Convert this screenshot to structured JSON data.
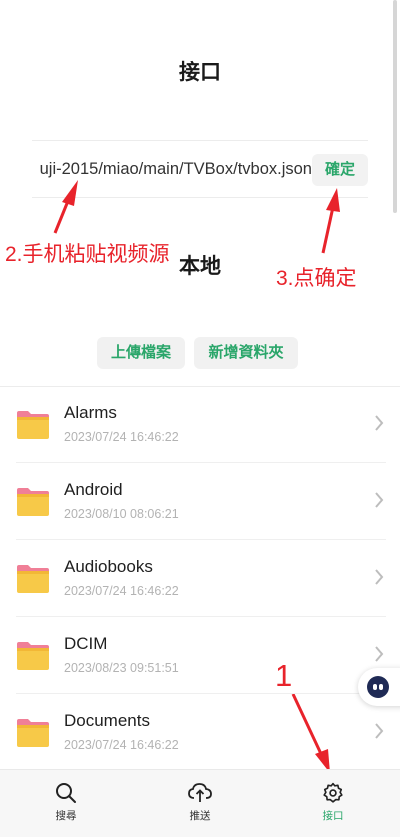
{
  "header": {
    "title": "接口"
  },
  "interface": {
    "url_value": "uji-2015/miao/main/TVBox/tvbox.json",
    "confirm_label": "確定"
  },
  "local": {
    "title": "本地",
    "upload_label": "上傳檔案",
    "new_folder_label": "新增資料夾"
  },
  "annotations": {
    "step2": "2.手机粘贴视频源",
    "step3": "3.点确定",
    "step1": "1",
    "color": "#e8232b"
  },
  "files": [
    {
      "name": "Alarms",
      "date": "2023/07/24 16:46:22",
      "icon": "folder-icon"
    },
    {
      "name": "Android",
      "date": "2023/08/10 08:06:21",
      "icon": "folder-icon"
    },
    {
      "name": "Audiobooks",
      "date": "2023/07/24 16:46:22",
      "icon": "folder-icon"
    },
    {
      "name": "DCIM",
      "date": "2023/08/23 09:51:51",
      "icon": "folder-icon"
    },
    {
      "name": "Documents",
      "date": "2023/07/24 16:46:22",
      "icon": "folder-icon"
    }
  ],
  "bottom_nav": [
    {
      "label": "搜尋",
      "icon": "search-icon",
      "active": false
    },
    {
      "label": "推送",
      "icon": "cloud-upload-icon",
      "active": false
    },
    {
      "label": "接口",
      "icon": "gear-icon",
      "active": true
    }
  ],
  "colors": {
    "accent": "#2aa66a",
    "annotation": "#e8232b",
    "folder": "#f7c948"
  }
}
